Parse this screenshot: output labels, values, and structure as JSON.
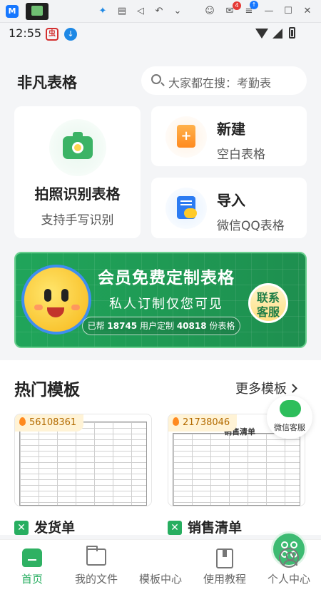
{
  "host_bar": {
    "icons": [
      "app-icon-blue",
      "app-thumbnail",
      "butterfly-icon",
      "keyboard-icon",
      "volume-icon",
      "undo-icon",
      "chevron-down-icon",
      "user-icon",
      "mail-icon",
      "menu-icon",
      "minimize-icon",
      "maximize-icon",
      "close-icon"
    ],
    "mail_badge": "4",
    "app_glyph": "M",
    "close": "✕",
    "minimize": "—",
    "maximize": "☐"
  },
  "status_bar": {
    "time": "12:55"
  },
  "header": {
    "title": "非凡表格",
    "search_placeholder": "大家都在搜：考勤表"
  },
  "cards": {
    "photo": {
      "title": "拍照识别表格",
      "subtitle": "支持手写识别"
    },
    "new": {
      "title": "新建",
      "subtitle": "空白表格"
    },
    "import": {
      "title": "导入",
      "subtitle": "微信QQ表格"
    }
  },
  "banner": {
    "title": "会员免费定制表格",
    "subtitle": "私人订制仅您可见",
    "stats_prefix": "已帮",
    "users_count": "18745",
    "stats_mid": "用户定制",
    "forms_count": "40818",
    "stats_suffix": "份表格",
    "button_line1": "联系",
    "button_line2": "客服"
  },
  "hot_templates": {
    "title": "热门模板",
    "more_label": "更多模板",
    "items": [
      {
        "heat": "56108361",
        "name": "发货单",
        "sheet_head": ""
      },
      {
        "heat": "21738046",
        "name": "销售清单",
        "sheet_head": "销售清单"
      }
    ]
  },
  "floating_service": {
    "label": "微信客服"
  },
  "nav": {
    "items": [
      {
        "label": "首页",
        "icon": "home-icon",
        "active": true
      },
      {
        "label": "我的文件",
        "icon": "folder-icon",
        "active": false
      },
      {
        "label": "模板中心",
        "icon": "grid-icon",
        "active": false
      },
      {
        "label": "使用教程",
        "icon": "book-icon",
        "active": false
      },
      {
        "label": "个人中心",
        "icon": "person-icon",
        "active": false
      }
    ]
  },
  "colors": {
    "brand_green": "#27ae60",
    "banner_green": "#20a55a",
    "accent_orange": "#ff8a1f",
    "accent_blue": "#2b7bf2"
  }
}
